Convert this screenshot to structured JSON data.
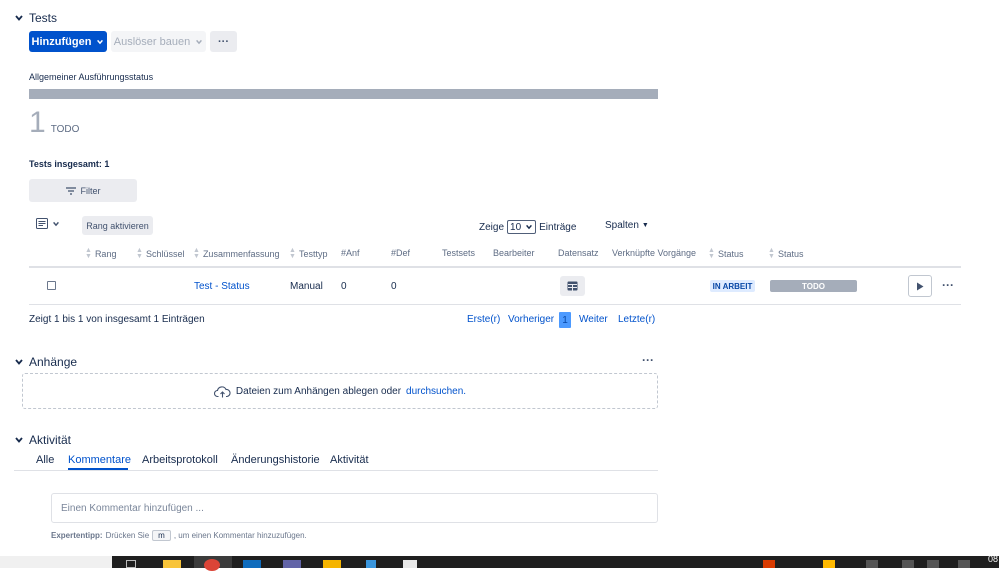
{
  "tests": {
    "title": "Tests",
    "add_button": "Hinzufügen",
    "trigger_button": "Auslöser bauen",
    "more_button": "···",
    "execution_status_label": "Allgemeiner Ausführungsstatus",
    "todo_count": "1",
    "todo_label": "TODO",
    "total_label": "Tests insgesamt: 1",
    "filter_button": "Filter",
    "rank_button": "Rang aktivieren",
    "show_label": "Zeige",
    "page_size": "10",
    "entries_label": "Einträge",
    "columns_button": "Spalten"
  },
  "table": {
    "headers": [
      "Rang",
      "Schlüssel",
      "Zusammenfassung",
      "Testtyp",
      "#Anf",
      "#Def",
      "Testsets",
      "Bearbeiter",
      "Datensatz",
      "Verknüpfte Vorgänge",
      "Status",
      "Status"
    ],
    "row": {
      "summary": "Test - Status",
      "type": "Manual",
      "anf": "0",
      "def": "0",
      "status1": "IN ARBEIT",
      "status2": "TODO"
    },
    "footer_text": "Zeigt 1 bis 1 von insgesamt 1 Einträgen",
    "pagination": {
      "first": "Erste(r)",
      "prev": "Vorheriger",
      "current": "1",
      "next": "Weiter",
      "last": "Letzte(r)"
    }
  },
  "attachments": {
    "title": "Anhänge",
    "more": "···",
    "drop_text": "Dateien zum Anhängen ablegen oder",
    "browse_link": "durchsuchen."
  },
  "activity": {
    "title": "Aktivität",
    "tabs": [
      "Alle",
      "Kommentare",
      "Arbeitsprotokoll",
      "Änderungshistorie",
      "Aktivität"
    ],
    "comment_placeholder": "Einen Kommentar hinzufügen ...",
    "tip_label": "Expertentipp:",
    "tip_text_1": "Drücken Sie",
    "tip_key": "m",
    "tip_text_2": ", um einen Kommentar hinzuzufügen."
  },
  "taskbar": {
    "clock": "08"
  },
  "colors": {
    "primary": "#0052cc",
    "progress_gray": "#a5adba",
    "in_progress_bg": "#deebff",
    "todo_bg": "#a5adba"
  }
}
